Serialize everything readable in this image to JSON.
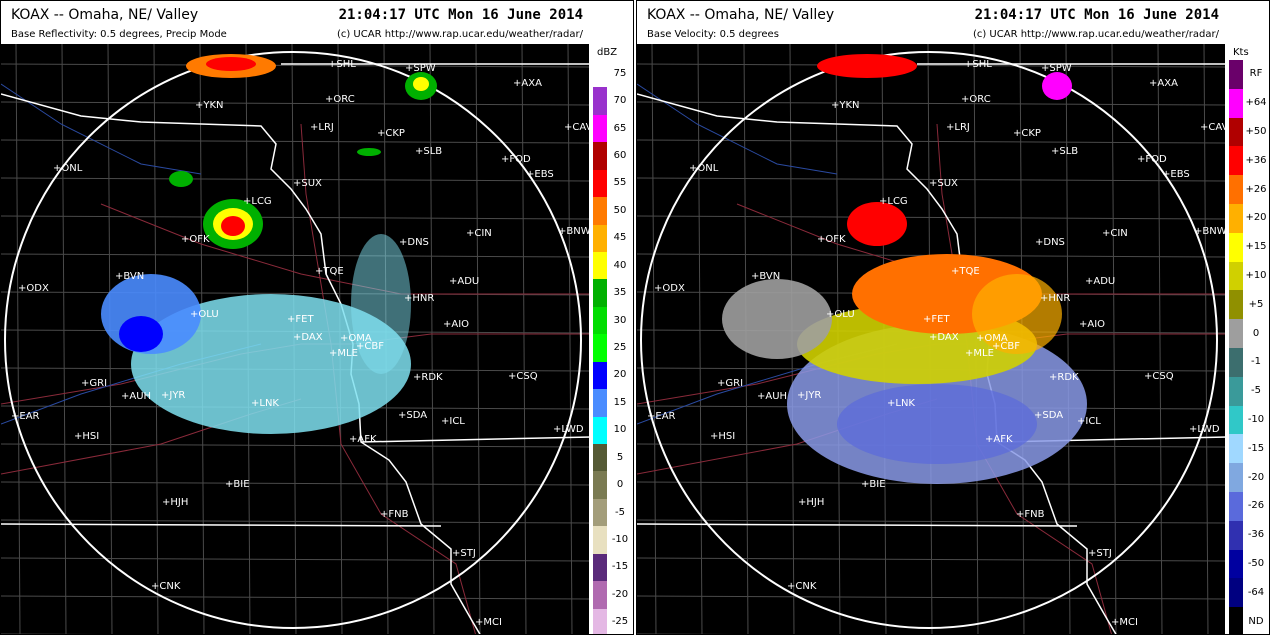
{
  "timestamp": "21:04:17 UTC Mon 16 June 2014",
  "credit": "(c) UCAR   http://www.rap.ucar.edu/weather/radar/",
  "panels": {
    "reflectivity": {
      "station": "KOAX -- Omaha, NE/ Valley",
      "product": "Base Reflectivity: 0.5 degrees, Precip Mode",
      "unit": "dBZ",
      "scale_labels": [
        "75",
        "70",
        "65",
        "60",
        "55",
        "50",
        "45",
        "40",
        "35",
        "30",
        "25",
        "20",
        "15",
        "10",
        "5",
        "0",
        "-5",
        "-10",
        "-15",
        "-20",
        "-25"
      ],
      "scale_colors": [
        "#ffffff",
        "#9932cc",
        "#ff00ff",
        "#b00000",
        "#ff0000",
        "#ff7a00",
        "#ffb000",
        "#ffff00",
        "#00b000",
        "#00dd00",
        "#00ff00",
        "#0000ff",
        "#4a8cff",
        "#00ffff",
        "#555a35",
        "#7a7a52",
        "#a39d7a",
        "#e8e0c0",
        "#5a2a7a",
        "#b06ab0",
        "#e4b8e4"
      ]
    },
    "velocity": {
      "station": "KOAX -- Omaha, NE/ Valley",
      "product": "Base Velocity: 0.5 degrees",
      "unit": "Kts",
      "scale_labels": [
        "RF",
        "+64",
        "+50",
        "+36",
        "+26",
        "+20",
        "+15",
        "+10",
        "+5",
        "0",
        "-1",
        "-5",
        "-10",
        "-15",
        "-20",
        "-26",
        "-36",
        "-50",
        "-64",
        "ND"
      ],
      "scale_colors": [
        "#6a006a",
        "#ff00ff",
        "#b00000",
        "#ff0000",
        "#ff7000",
        "#ffb000",
        "#ffff00",
        "#d0d000",
        "#909000",
        "#9e9e9e",
        "#3c6e6e",
        "#3a9a9a",
        "#30c8c8",
        "#a0d8ff",
        "#80a8e0",
        "#5a6adc",
        "#3030b0",
        "#0000a0",
        "#000080",
        "#000000"
      ]
    }
  },
  "city_labels": [
    "SHL",
    "SPW",
    "AXA",
    "YKN",
    "ORC",
    "LRJ",
    "CKP",
    "CAV",
    "SLB",
    "FOD",
    "ONL",
    "SUX",
    "EBS",
    "LCG",
    "OFK",
    "DNS",
    "CIN",
    "BNW",
    "BVN",
    "TQE",
    "ADU",
    "ODX",
    "HNR",
    "OLU",
    "FET",
    "AIO",
    "OMA",
    "DAX",
    "CBF",
    "MLE",
    "GRI",
    "AUH",
    "JYR",
    "RDK",
    "CSQ",
    "LNK",
    "SDA",
    "ICL",
    "EAR",
    "HSI",
    "AFK",
    "LWD",
    "BIE",
    "HJH",
    "FNB",
    "STJ",
    "CNK",
    "MCI"
  ]
}
